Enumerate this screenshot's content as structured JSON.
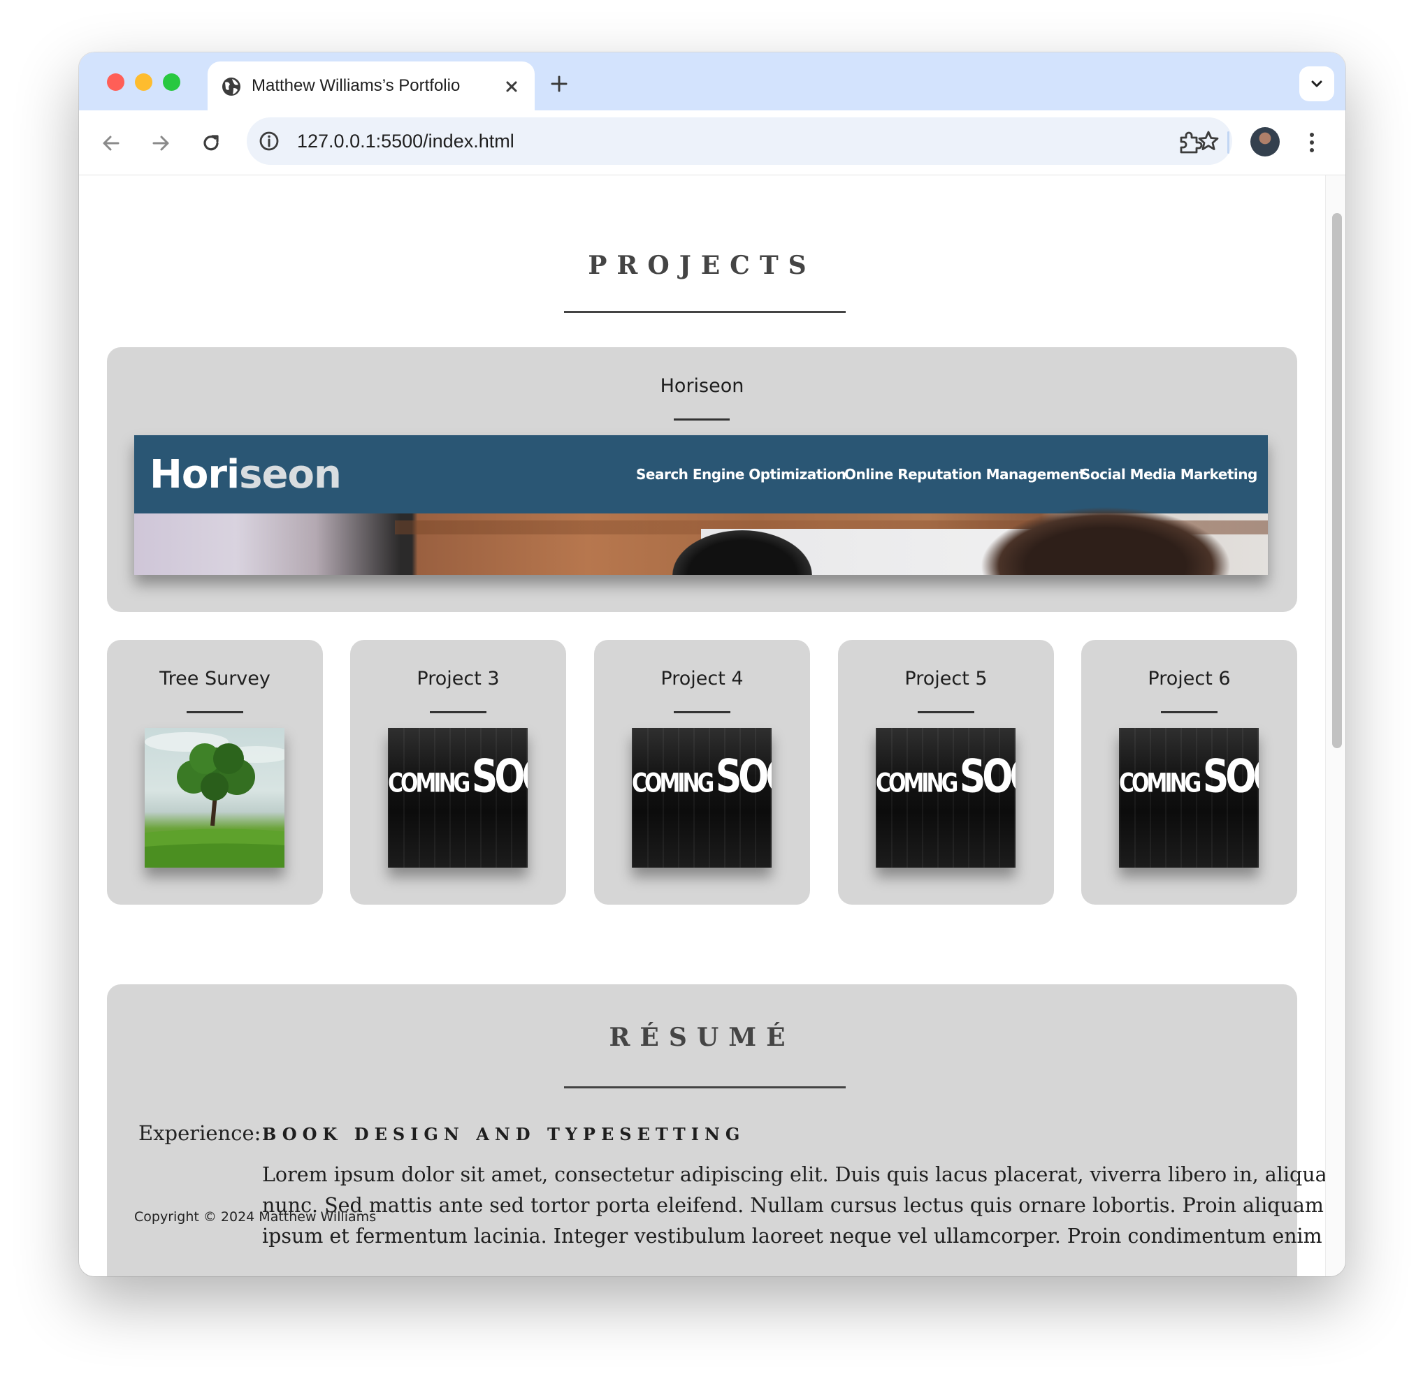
{
  "browser": {
    "tab_title": "Matthew Williams’s Portfolio",
    "url": "127.0.0.1:5500/index.html"
  },
  "projects": {
    "heading": "PROJECTS",
    "featured": {
      "title": "Horiseon",
      "screenshot": {
        "logo_main": "Hori",
        "logo_highlight": "seon",
        "nav": [
          "Search Engine Optimization",
          "Online Reputation Management",
          "Social Media Marketing"
        ]
      }
    },
    "items": [
      {
        "title": "Tree Survey",
        "image": "tree"
      },
      {
        "title": "Project 3",
        "image": "coming-soon",
        "soon_top": "COMING",
        "soon_bottom": "SOON"
      },
      {
        "title": "Project 4",
        "image": "coming-soon",
        "soon_top": "COMING",
        "soon_bottom": "SOON"
      },
      {
        "title": "Project 5",
        "image": "coming-soon",
        "soon_top": "COMING",
        "soon_bottom": "SOON"
      },
      {
        "title": "Project 6",
        "image": "coming-soon",
        "soon_top": "COMING",
        "soon_bottom": "SOON"
      }
    ]
  },
  "resume": {
    "heading": "RÉSUMÉ",
    "experience_label": "Experience:",
    "experience_title": "BOOK DESIGN AND TYPESETTING",
    "experience_lines": [
      "Lorem ipsum dolor sit amet, consectetur adipiscing elit. Duis quis lacus placerat, viverra libero in, aliquam",
      "nunc. Sed mattis ante sed tortor porta eleifend. Nullam cursus lectus quis ornare lobortis. Proin aliquam",
      "ipsum et fermentum lacinia. Integer vestibulum laoreet neque vel ullamcorper. Proin condimentum enim eu"
    ]
  },
  "footer": {
    "copyright": "Copyright © 2024 Matthew Williams"
  },
  "colors": {
    "tab_strip": "#d3e3fd",
    "card": "#d6d6d6",
    "horiseon_header": "#2a5674"
  }
}
